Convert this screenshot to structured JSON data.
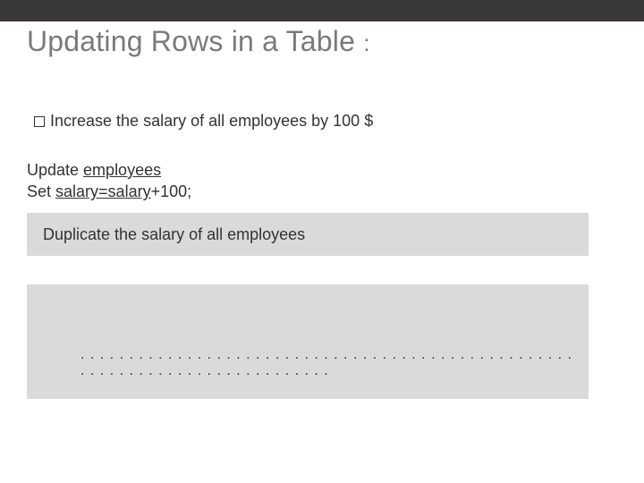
{
  "title": "Updating Rows in a Table",
  "title_colon": ":",
  "bullet": "Increase the salary of all employees by 100 $",
  "sql": {
    "line1_prefix": "Update ",
    "line1_underlined": "employees",
    "line2_prefix": "Set ",
    "line2_underlined": "salary=salary",
    "line2_suffix": "+100;"
  },
  "box1": "Duplicate the salary of all employees",
  "box2_dots": ". . . . . . . . . . . . . . . . . . . . . . . . . . . . . . . . . . . . . . . . . . . . . . . . . . . . . . . . . . . . . . . . . . . . . . . . . . . . ."
}
